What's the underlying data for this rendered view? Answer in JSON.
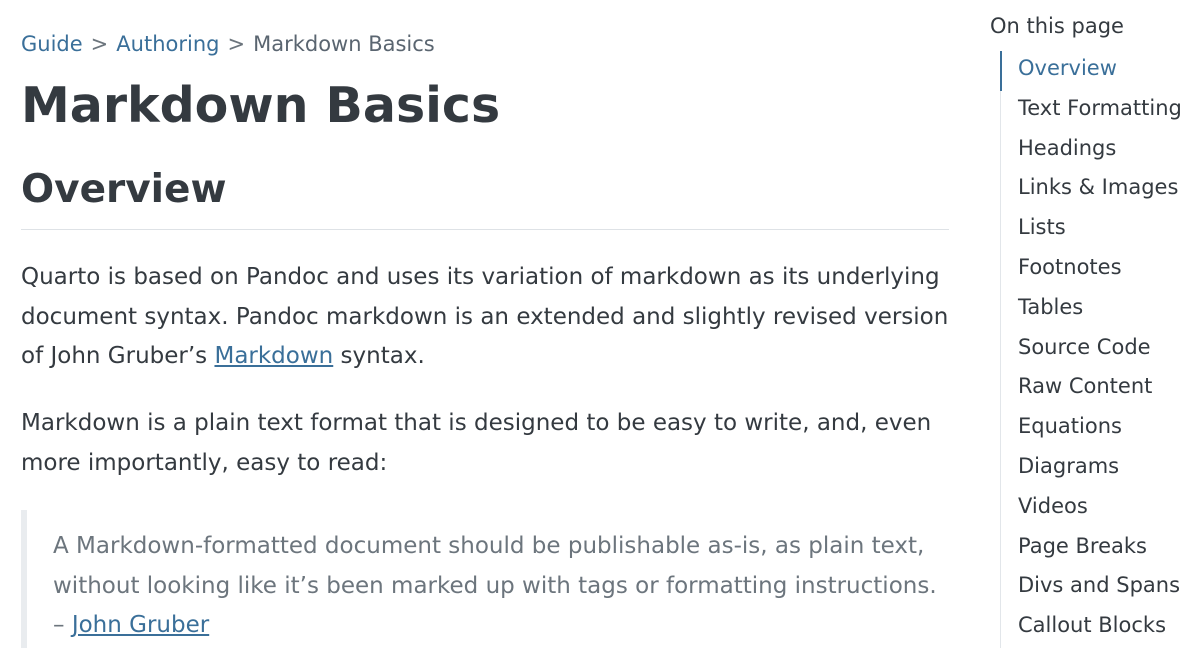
{
  "breadcrumb": {
    "items": [
      "Guide",
      "Authoring",
      "Markdown Basics"
    ],
    "separator": ">"
  },
  "page_title": "Markdown Basics",
  "section_heading": "Overview",
  "paragraphs": {
    "p1_before_link": "Quarto is based on Pandoc and uses its variation of markdown as its underlying document syntax. Pandoc markdown is an extended and slightly revised version of John Gruber’s ",
    "p1_link": "Markdown",
    "p1_after_link": " syntax.",
    "p2": "Markdown is a plain text format that is designed to be easy to write, and, even more importantly, easy to read:"
  },
  "blockquote": {
    "text": "A Markdown-formatted document should be publishable as-is, as plain text, without looking like it’s been marked up with tags or formatting instructions.",
    "attribution_prefix": "– ",
    "attribution_link": "John Gruber"
  },
  "toc": {
    "title": "On this page",
    "active_index": 0,
    "items": [
      "Overview",
      "Text Formatting",
      "Headings",
      "Links & Images",
      "Lists",
      "Footnotes",
      "Tables",
      "Source Code",
      "Raw Content",
      "Equations",
      "Diagrams",
      "Videos",
      "Page Breaks",
      "Divs and Spans",
      "Callout Blocks"
    ]
  },
  "colors": {
    "link": "#3a6f99",
    "text": "#343a40",
    "muted": "#6c757d",
    "blockquote_border": "#e9ecef",
    "divider": "#dee2e6"
  }
}
